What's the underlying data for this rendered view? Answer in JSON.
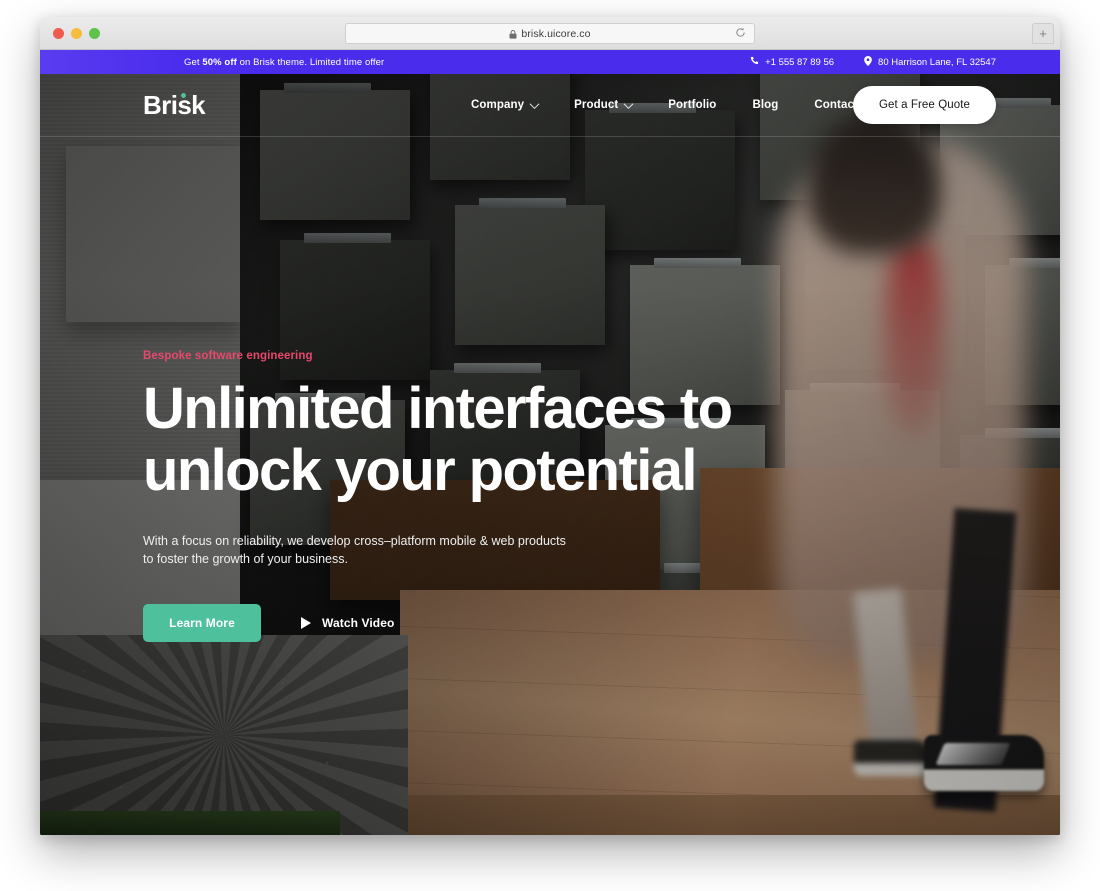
{
  "browser": {
    "url": "brisk.uicore.co",
    "lock_icon": "lock-icon",
    "reload_icon": "reload-icon",
    "new_tab_label": "+",
    "traffic_lights": [
      "close",
      "minimize",
      "maximize"
    ]
  },
  "promo": {
    "text_prefix": "Get ",
    "text_bold": "50% off",
    "text_suffix": " on Brisk theme. Limited time offer",
    "phone_icon": "phone-icon",
    "phone": "+1 555 87 89 56",
    "location_icon": "map-pin-icon",
    "address": "80 Harrison Lane, FL 32547",
    "background_color": "#4a2ced"
  },
  "nav": {
    "logo": "Brisk",
    "logo_dot_color": "#4ec19c",
    "links": [
      {
        "label": "Company",
        "has_dropdown": true,
        "icon": "chevron-down-icon"
      },
      {
        "label": "Product",
        "has_dropdown": true,
        "icon": "chevron-down-icon"
      },
      {
        "label": "Portfolio",
        "has_dropdown": false
      },
      {
        "label": "Blog",
        "has_dropdown": false
      },
      {
        "label": "Contact",
        "has_dropdown": false
      }
    ],
    "cta_label": "Get a Free Quote"
  },
  "hero": {
    "eyebrow": "Bespoke software engineering",
    "eyebrow_color": "#e8486e",
    "headline": "Unlimited interfaces to unlock your potential",
    "subhead": "With a focus on reliability, we develop cross–platform mobile & web products to foster the growth of your business.",
    "primary_button": "Learn More",
    "primary_button_color": "#4ec19c",
    "video_button": "Watch Video",
    "play_icon": "play-icon"
  }
}
